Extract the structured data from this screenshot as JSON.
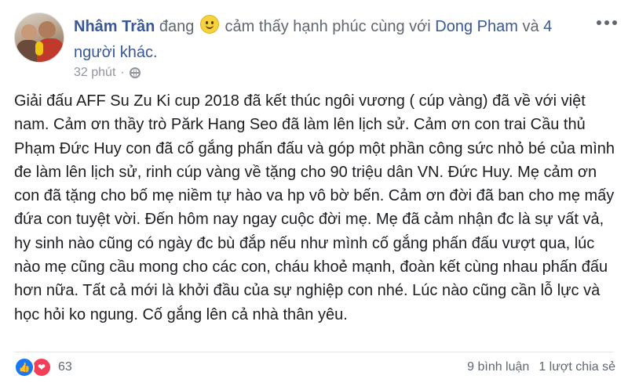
{
  "author": {
    "name": "Nhâm Trần",
    "status_prefix": "đang",
    "feeling": "cảm thấy hạnh phúc cùng với",
    "tagged": "Dong Pham",
    "connector": "và",
    "others": "4 người khác."
  },
  "timestamp": "32 phút",
  "privacy_icon": "globe-icon",
  "post_text": "Giải đấu AFF Su Zu Ki cup 2018 đã kết thúc ngôi vương ( cúp vàng) đã về với việt nam. Cảm ơn thầy trò Părk Hang Seo đã làm lên lịch sử. Cảm ơn con trai Cầu thủ Phạm Đức Huy con đã cố gắng phấn đấu và góp một phần công sức nhỏ bé của mình đe làm lên lịch sử, rinh cúp vàng về tặng cho 90 triệu dân VN. Đức Huy. Mẹ cảm ơn con đã tặng cho bố mẹ niềm tự hào va hp vô bờ bến. Cảm ơn đời đã ban cho mẹ mấy đứa con tuyệt vời. Đến hôm nay ngay cuộc đời mẹ. Mẹ đã cảm nhận đc là sự vất vả, hy sinh nào cũng có ngày đc bù đắp nếu như mình cố gắng phấn đấu vượt qua, lúc nào mẹ cũng cầu mong cho các con, cháu khoẻ mạnh, đoàn kết cùng nhau phấn đấu hơn nữa. Tất cả mới là khởi đầu của sự nghiệp con nhé. Lúc nào cũng cần lỗ lực và học hỏi ko ngung. Cố gắng lên cả nhà thân yêu.",
  "reactions": {
    "icons": [
      "like-icon",
      "love-icon"
    ],
    "count": "63"
  },
  "stats": {
    "comments": "9 bình luận",
    "shares": "1 lượt chia sẻ"
  },
  "colors": {
    "link": "#385898",
    "meta": "#90949c",
    "like": "#1877f2",
    "love": "#f33e58"
  }
}
